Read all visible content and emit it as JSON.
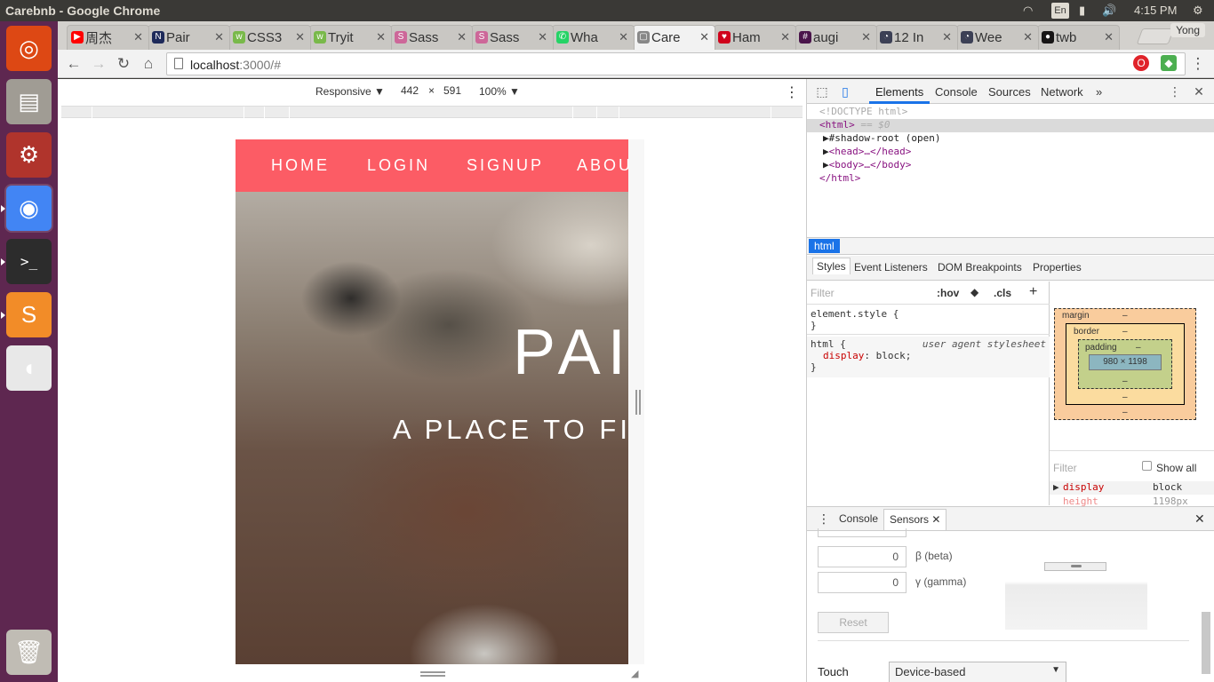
{
  "system": {
    "window_title": "Carebnb - Google Chrome",
    "keyboard_indicator": "En",
    "time": "4:15 PM"
  },
  "launcher": {
    "items": [
      {
        "name": "ubuntu-dash-icon",
        "glyph": "◎",
        "color": "#dd4814"
      },
      {
        "name": "files-icon",
        "glyph": "▤",
        "color": "#a09c94"
      },
      {
        "name": "system-settings-icon",
        "glyph": "⚙",
        "color": "#b0342c"
      },
      {
        "name": "chrome-icon",
        "glyph": "◉",
        "color": "#4285f4"
      },
      {
        "name": "terminal-icon",
        "glyph": ">_",
        "color": "#2c2c2c"
      },
      {
        "name": "sublime-text-icon",
        "glyph": "S",
        "color": "#f28c28"
      },
      {
        "name": "mouse-settings-icon",
        "glyph": "◖",
        "color": "#e8e8e8"
      },
      {
        "name": "trash-icon",
        "glyph": "🗑",
        "color": "#c0bcb4"
      }
    ]
  },
  "tabs": [
    {
      "label": "周杰",
      "icon_color": "#ff0000",
      "icon": "▶"
    },
    {
      "label": "Pair",
      "icon_color": "#1e2a5a",
      "icon": "N"
    },
    {
      "label": "CSS3",
      "icon_color": "#79b94a",
      "icon": "w"
    },
    {
      "label": "Tryit",
      "icon_color": "#79b94a",
      "icon": "w"
    },
    {
      "label": "Sass",
      "icon_color": "#cd6799",
      "icon": "S"
    },
    {
      "label": "Sass",
      "icon_color": "#cd6799",
      "icon": "S"
    },
    {
      "label": "Wha",
      "icon_color": "#25d366",
      "icon": "✆"
    },
    {
      "label": "Care",
      "icon_color": "#888888",
      "icon": "▢"
    },
    {
      "label": "Ham",
      "icon_color": "#d0021b",
      "icon": "♥"
    },
    {
      "label": "augi",
      "icon_color": "#4a154b",
      "icon": "#"
    },
    {
      "label": "12 In",
      "icon_color": "#3c4055",
      "icon": "◔"
    },
    {
      "label": "Wee",
      "icon_color": "#3c4055",
      "icon": "◔"
    },
    {
      "label": "twb",
      "icon_color": "#171515",
      "icon": "●"
    }
  ],
  "profile_name": "Yong",
  "address_bar": {
    "host": "localhost",
    "path": ":3000/#"
  },
  "device_toolbar": {
    "device": "Responsive",
    "width": "442",
    "times": "×",
    "height": "591",
    "zoom": "100%"
  },
  "site": {
    "nav": [
      "HOME",
      "LOGIN",
      "SIGNUP",
      "ABOUT"
    ],
    "hero_title": "PAI",
    "hero_subtitle": "A PLACE TO FIN",
    "nav_color": "#fc5c65"
  },
  "devtools": {
    "tabs": [
      "Elements",
      "Console",
      "Sources",
      "Network"
    ],
    "more": "»",
    "dom": {
      "doctype": "<!DOCTYPE html>",
      "html_open": "<html>",
      "eq": " == $0",
      "shadow": "#shadow-root (open)",
      "head": "<head>…</head>",
      "body": "<body>…</body>",
      "html_close": "</html>"
    },
    "breadcrumb": "html",
    "styles_tabs": [
      "Styles",
      "Event Listeners",
      "DOM Breakpoints",
      "Properties"
    ],
    "filter_placeholder": "Filter",
    "hov": ":hov",
    "cls": ".cls",
    "add": "+",
    "rules": {
      "element_style": "element.style {",
      "close": "}",
      "html_selector": "html {",
      "ua_label": "user agent stylesheet",
      "prop": "display",
      "value": "block;"
    },
    "box_model": {
      "margin": "margin",
      "border": "border",
      "padding": "padding",
      "dash": "–",
      "content": "980 × 1198"
    },
    "computed": {
      "filter": "Filter",
      "show_all": "Show all",
      "rows": [
        {
          "prop": "display",
          "value": "block"
        },
        {
          "prop": "height",
          "value": "1198px"
        }
      ]
    },
    "drawer": {
      "tabs": [
        "Console",
        "Sensors"
      ]
    },
    "sensors": {
      "beta_value": "0",
      "beta_label": "β (beta)",
      "gamma_value": "0",
      "gamma_label": "γ (gamma)",
      "reset": "Reset",
      "touch_label": "Touch",
      "touch_value": "Device-based"
    }
  }
}
